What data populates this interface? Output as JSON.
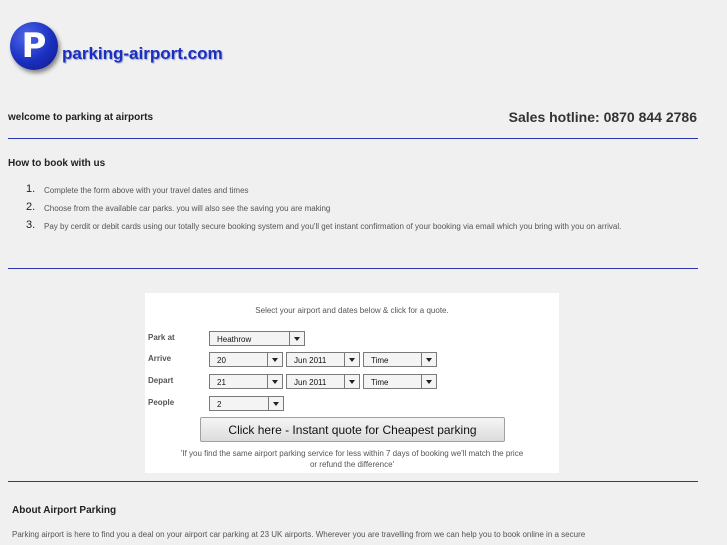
{
  "logo": {
    "letter": "P",
    "text": "parking-airport.com"
  },
  "header": {
    "welcome": "welcome to parking at airports",
    "hotline": "Sales hotline:  0870 844 2786"
  },
  "how_to_book": {
    "title": "How to book with us",
    "steps": [
      {
        "num": "1.",
        "text": "Complete the form above with your travel dates and times"
      },
      {
        "num": "2.",
        "text": "Choose from the available car parks. you will also see the saving you are making"
      },
      {
        "num": "3.",
        "text": "Pay by cerdit or debit cards using our totally secure booking system and you'll get instant confirmation of your booking via email which you bring with you on arrival."
      }
    ]
  },
  "form": {
    "intro": "Select your airport and dates below & click for a quote.",
    "park_at_label": "Park at",
    "park_at_value": "Heathrow",
    "arrive_label": "Arrive",
    "arrive_day": "20",
    "arrive_month": "Jun 2011",
    "arrive_time": "Time",
    "depart_label": "Depart",
    "depart_day": "21",
    "depart_month": "Jun 2011",
    "depart_time": "Time",
    "people_label": "People",
    "people_value": "2",
    "submit_label": "Click here - Instant quote for Cheapest parking",
    "guarantee_line1": "'If you find the same airport parking service for less within 7 days of booking we'll match the price",
    "guarantee_line2": "or refund the difference'"
  },
  "about": {
    "title": "About Airport Parking",
    "text": "Parking airport is here to find you a deal on your airport car parking at 23 UK airports. Wherever you are travelling from we can help you to book online in a secure"
  },
  "colors": {
    "brand_blue": "#1a2fc0",
    "rule_blue": "#2a35b0"
  }
}
